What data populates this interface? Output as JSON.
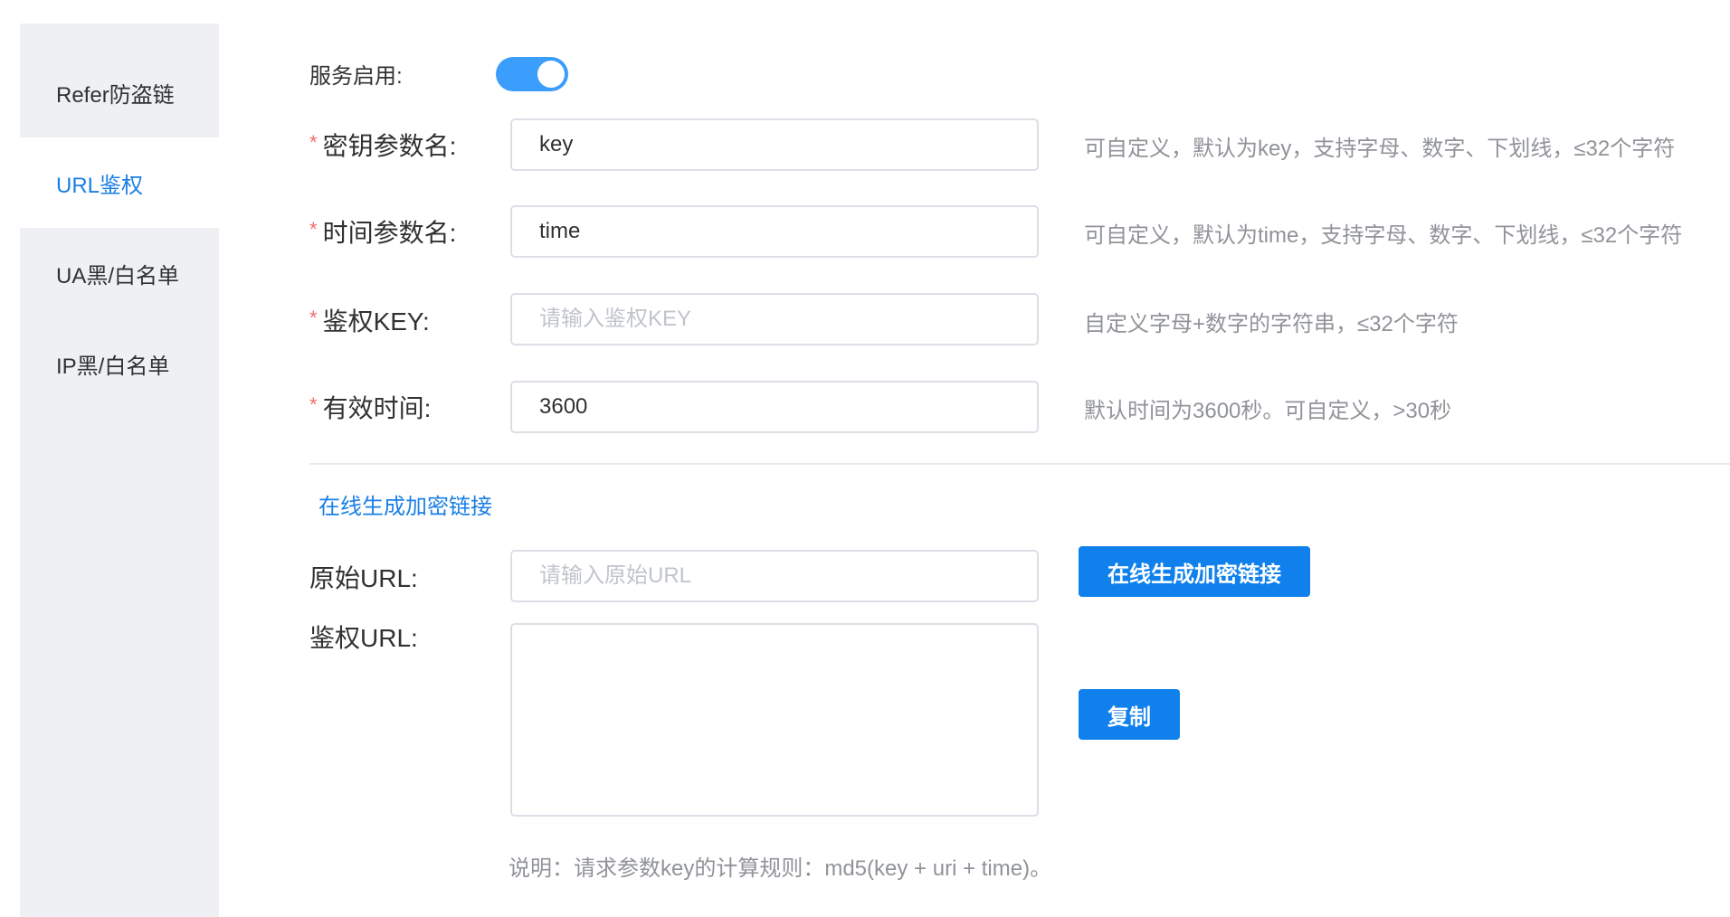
{
  "sidebar": {
    "items": [
      {
        "label": "Refer防盗链"
      },
      {
        "label": "URL鉴权"
      },
      {
        "label": "UA黑/白名单"
      },
      {
        "label": "IP黑/白名单"
      }
    ]
  },
  "form": {
    "service_enabled": {
      "label": "服务启用:",
      "value": true
    },
    "key_param": {
      "label": "密钥参数名:",
      "value": "key",
      "hint": "可自定义，默认为key，支持字母、数字、下划线，≤32个字符"
    },
    "time_param": {
      "label": "时间参数名:",
      "value": "time",
      "hint": "可自定义，默认为time，支持字母、数字、下划线，≤32个字符"
    },
    "auth_key": {
      "label": "鉴权KEY:",
      "placeholder": "请输入鉴权KEY",
      "hint": "自定义字母+数字的字符串，≤32个字符"
    },
    "valid_time": {
      "label": "有效时间:",
      "value": "3600",
      "hint": "默认时间为3600秒。可自定义，>30秒"
    }
  },
  "generator": {
    "section_title": "在线生成加密链接",
    "origin_url": {
      "label": "原始URL:",
      "placeholder": "请输入原始URL"
    },
    "generate_button": "在线生成加密链接",
    "auth_url": {
      "label": "鉴权URL:",
      "value": ""
    },
    "copy_button": "复制",
    "note": "说明：请求参数key的计算规则：md5(key + uri + time)。"
  },
  "colors": {
    "accent": "#1a7fe5",
    "button": "#0f80ec",
    "required": "#f56c6c"
  }
}
